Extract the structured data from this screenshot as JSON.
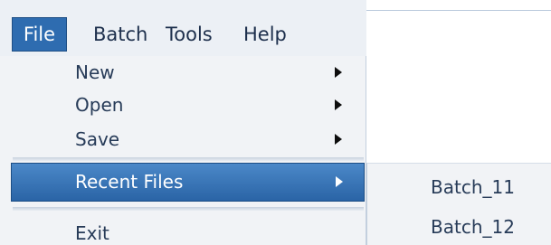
{
  "menubar": {
    "items": [
      {
        "label": "File",
        "active": true
      },
      {
        "label": "Batch"
      },
      {
        "label": "Tools"
      },
      {
        "label": "Help"
      }
    ]
  },
  "file_menu": {
    "items": [
      {
        "label": "New",
        "has_submenu": true
      },
      {
        "label": "Open",
        "has_submenu": true
      },
      {
        "label": "Save",
        "has_submenu": true
      },
      {
        "label": "Recent Files",
        "has_submenu": true,
        "highlighted": true
      },
      {
        "label": "Exit",
        "has_submenu": false
      }
    ]
  },
  "recent_files_submenu": {
    "items": [
      {
        "label": "Batch_11"
      },
      {
        "label": "Batch_12"
      }
    ]
  },
  "colors": {
    "highlight": "#2e6cb0",
    "menu_background": "#f1f3f6",
    "menu_text": "#273b58"
  },
  "icons": {
    "submenu_arrow": "chevron-right-icon"
  }
}
